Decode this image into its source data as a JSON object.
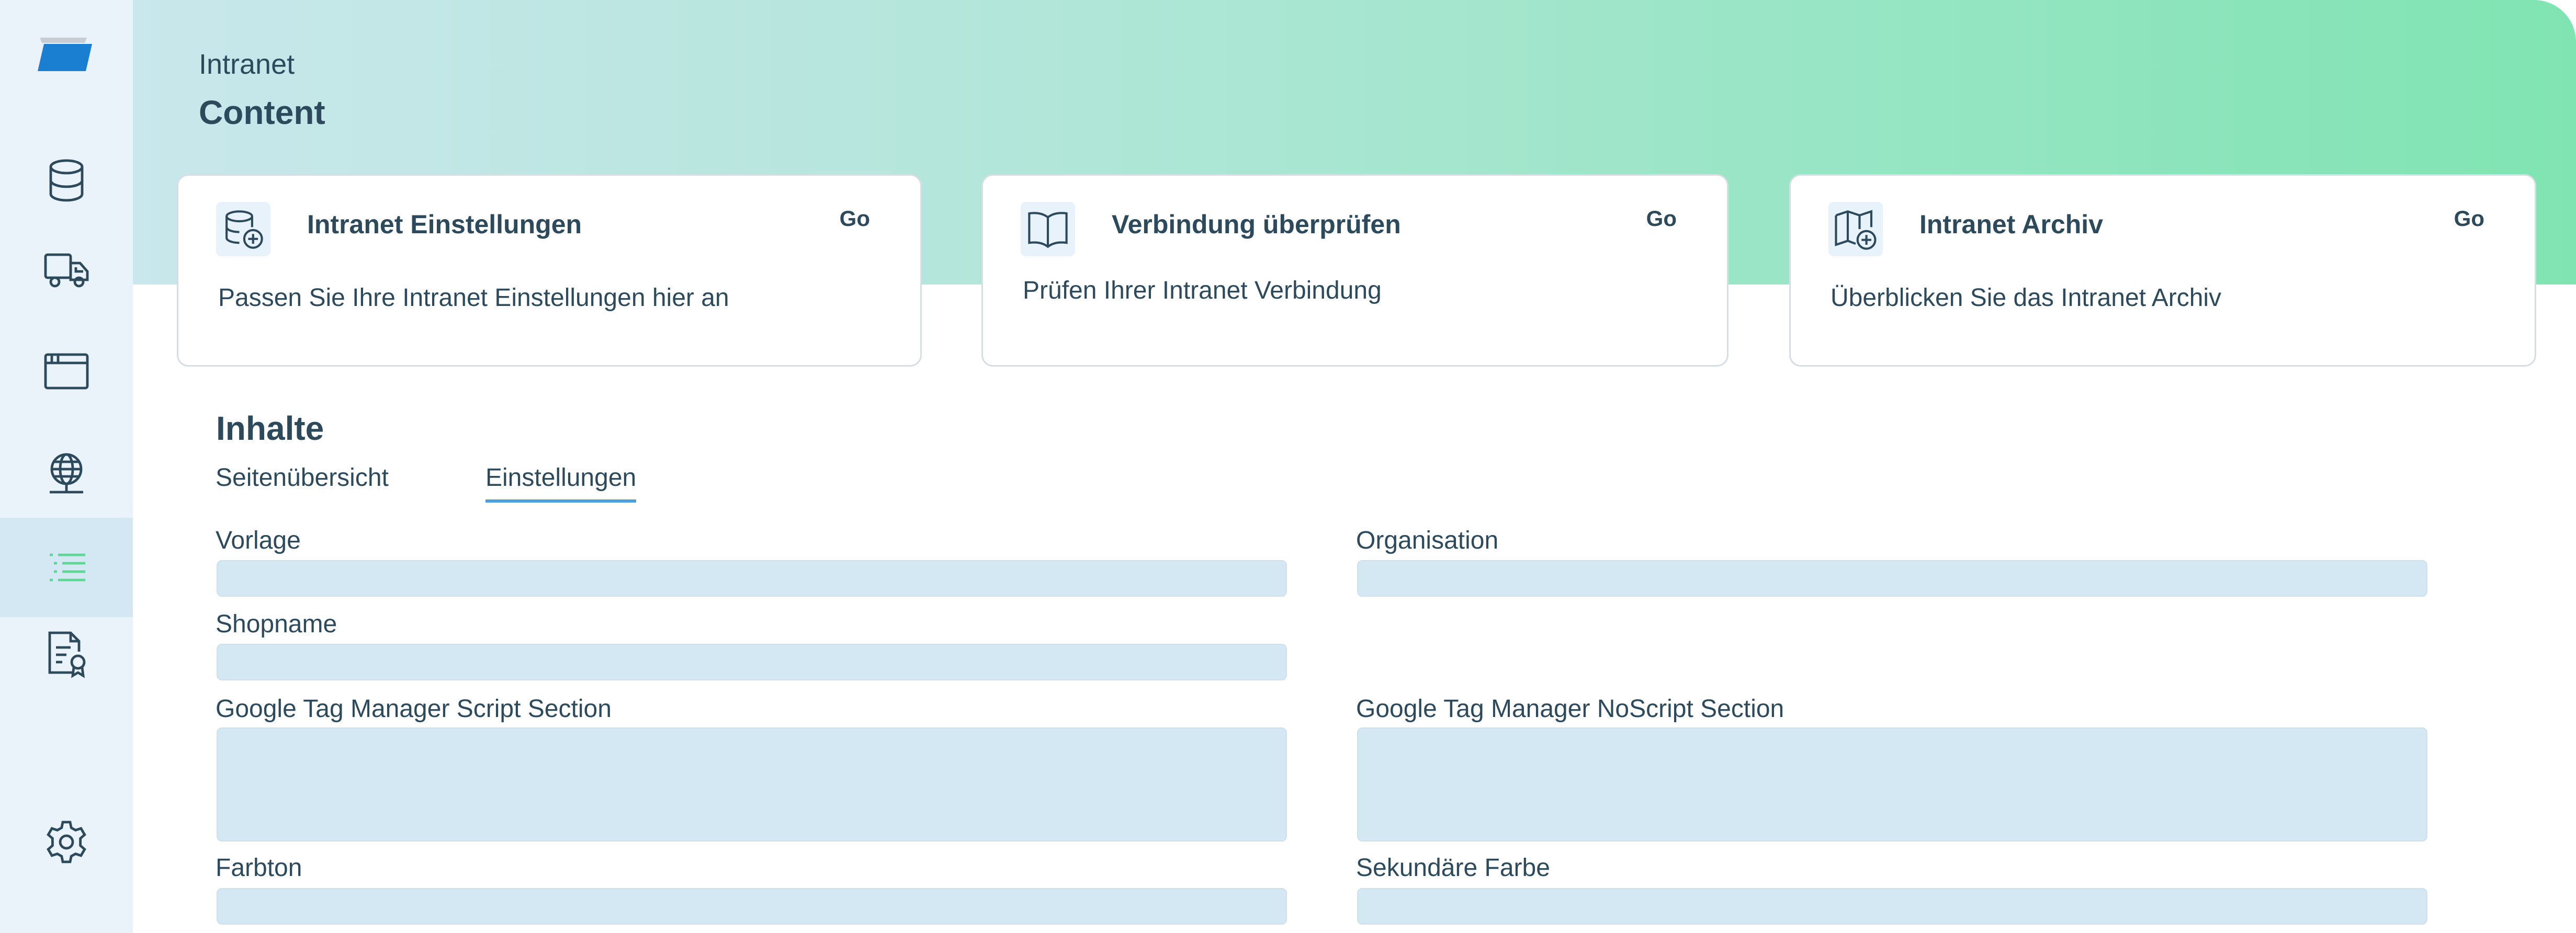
{
  "header": {
    "breadcrumb": "Intranet",
    "title": "Content"
  },
  "sidebar": {
    "items": [
      {
        "name": "database",
        "active": false
      },
      {
        "name": "truck",
        "active": false
      },
      {
        "name": "browser-window",
        "active": false
      },
      {
        "name": "globe",
        "active": false
      },
      {
        "name": "list",
        "active": true
      },
      {
        "name": "certificate",
        "active": false
      },
      {
        "name": "settings",
        "active": false
      }
    ]
  },
  "cards": [
    {
      "title": "Intranet Einstellungen",
      "go": "Go",
      "description": "Passen Sie Ihre Intranet Einstellungen hier an",
      "icon": "database-plus-icon"
    },
    {
      "title": "Verbindung überprüfen",
      "go": "Go",
      "description": "Prüfen Ihrer Intranet Verbindung",
      "icon": "book-icon"
    },
    {
      "title": "Intranet Archiv",
      "go": "Go",
      "description": "Überblicken Sie das Intranet Archiv",
      "icon": "map-plus-icon"
    }
  ],
  "section": {
    "title": "Inhalte",
    "tabs": [
      {
        "label": "Seitenübersicht",
        "active": false
      },
      {
        "label": "Einstellungen",
        "active": true
      }
    ]
  },
  "form": {
    "vorlage": {
      "label": "Vorlage",
      "value": ""
    },
    "organisation": {
      "label": "Organisation",
      "value": ""
    },
    "shopname": {
      "label": "Shopname",
      "value": ""
    },
    "gtm_script": {
      "label": "Google Tag Manager Script Section",
      "value": ""
    },
    "gtm_noscript": {
      "label": "Google Tag Manager NoScript Section",
      "value": ""
    },
    "farbton": {
      "label": "Farbton",
      "value": ""
    },
    "sekundaere_farbe": {
      "label": "Sekundäre Farbe",
      "value": ""
    }
  },
  "colors": {
    "sidebar_bg": "#eaf2fa",
    "sidebar_active": "#d4e8f3",
    "hero_start": "#c9e7ec",
    "hero_end": "#80e4b2",
    "text": "#2d4a5c",
    "input_bg": "#d3e8f3",
    "tab_underline": "#4a9fdc",
    "active_icon": "#5ed694",
    "logo": "#1a7fd1"
  }
}
